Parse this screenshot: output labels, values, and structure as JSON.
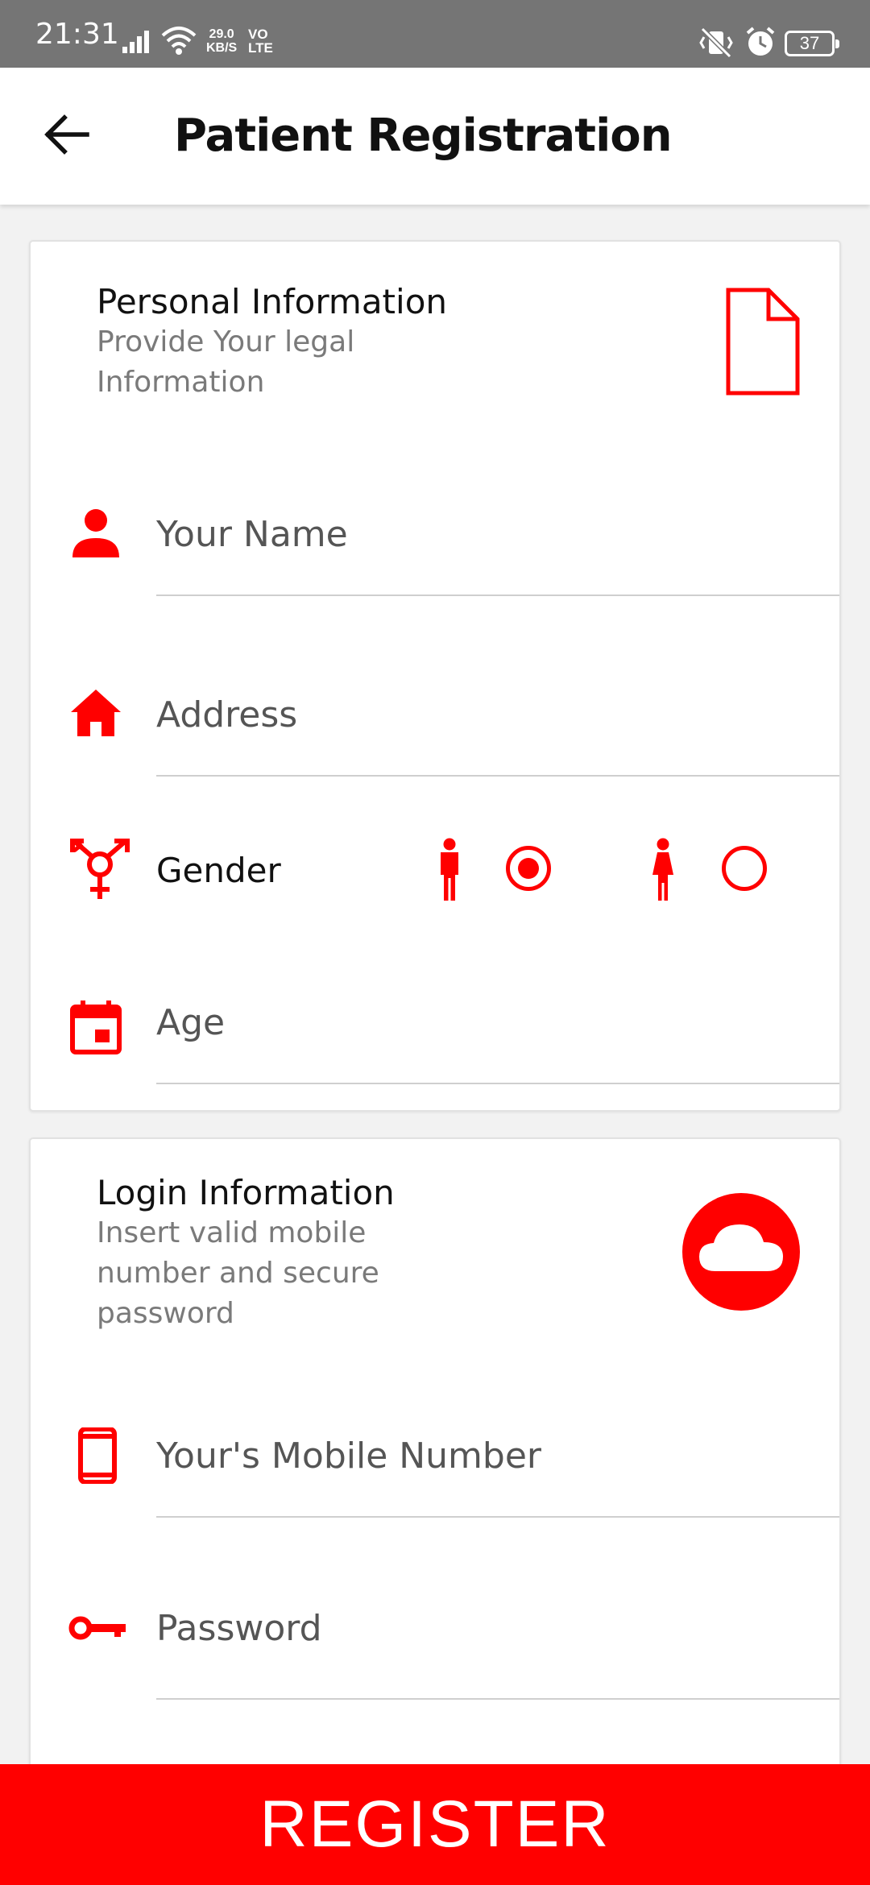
{
  "status_bar": {
    "time": "21:31",
    "net_speed_value": "29.0",
    "net_speed_unit": "KB/S",
    "volte_top": "VO",
    "volte_bottom": "LTE",
    "battery": "37"
  },
  "app_bar": {
    "title": "Patient Registration",
    "back_icon": "arrow-back-icon"
  },
  "personal_card": {
    "title": "Personal Information",
    "subtitle": "Provide Your legal Information",
    "header_icon": "document-icon",
    "name_placeholder": "Your Name",
    "address_placeholder": "Address",
    "gender_label": "Gender",
    "gender_options": [
      {
        "icon": "male-icon",
        "selected": true
      },
      {
        "icon": "female-icon",
        "selected": false
      }
    ],
    "age_placeholder": "Age"
  },
  "login_card": {
    "title": "Login Information",
    "subtitle": "Insert valid mobile number and secure password",
    "header_icon": "cloud-icon",
    "mobile_placeholder": "Your's Mobile Number",
    "password_placeholder": "Password"
  },
  "register_button": "REGISTER",
  "colors": {
    "accent": "#ff0000",
    "status_bar": "#757575",
    "text_primary": "#111111",
    "text_secondary": "#7a7a7a"
  }
}
